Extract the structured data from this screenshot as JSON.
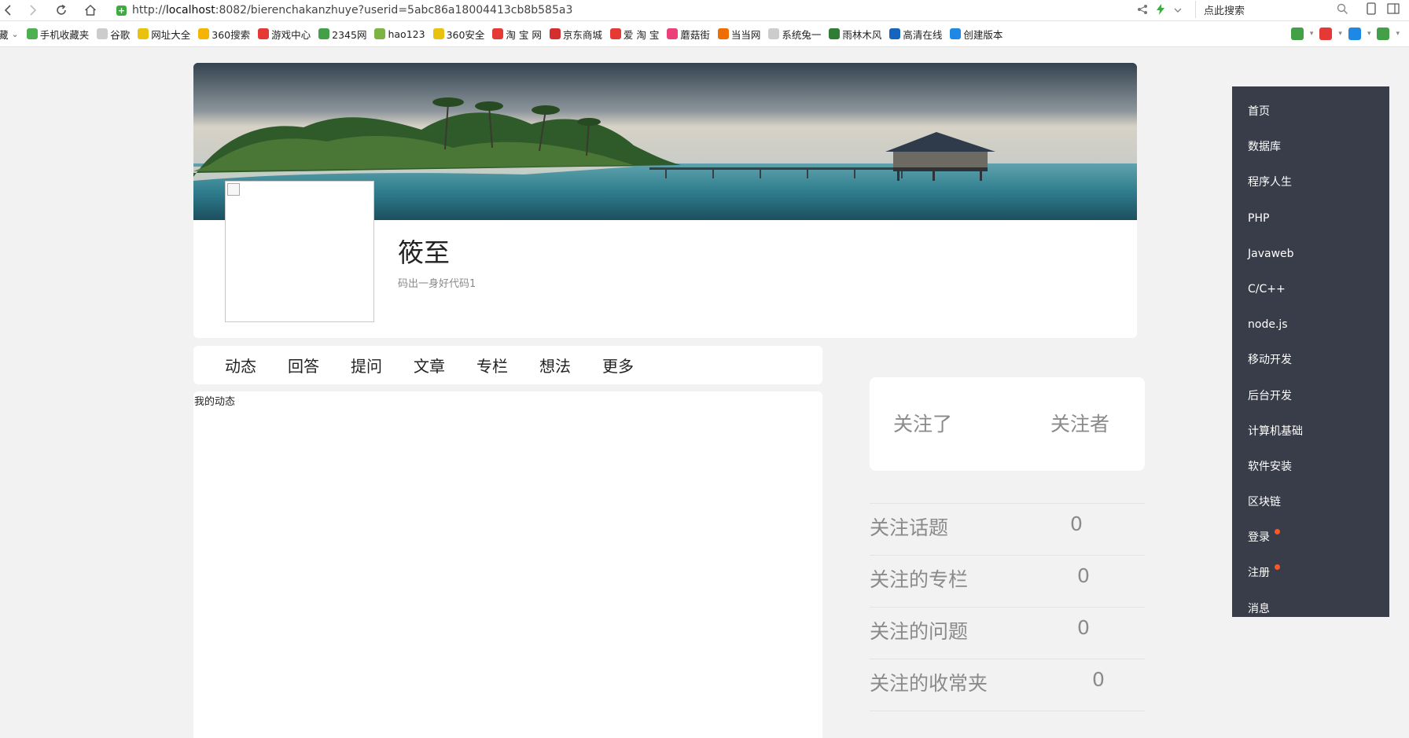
{
  "browser": {
    "url_prefix": "http://",
    "url_host": "localhost",
    "url_rest": ":8082/bierenchakanzhuye?userid=5abc86a18004413cb8b585a3",
    "search_placeholder": "点此搜索"
  },
  "bookmarks": [
    {
      "label": "藏",
      "icon": "folder-icon",
      "color": "#f0c419"
    },
    {
      "label": "手机收藏夹",
      "icon": "phone-icon",
      "color": "#4caf50"
    },
    {
      "label": "谷歌",
      "icon": "page-icon",
      "color": "#cccccc"
    },
    {
      "label": "网址大全",
      "icon": "sites-icon",
      "color": "#e8c20e"
    },
    {
      "label": "360搜索",
      "icon": "search360-icon",
      "color": "#f4b400"
    },
    {
      "label": "游戏中心",
      "icon": "game-icon",
      "color": "#e53935"
    },
    {
      "label": "2345网",
      "icon": "2345-icon",
      "color": "#43a047"
    },
    {
      "label": "hao123",
      "icon": "hao123-icon",
      "color": "#7cb342"
    },
    {
      "label": "360安全",
      "icon": "safe360-icon",
      "color": "#e8c20e"
    },
    {
      "label": "淘 宝 网",
      "icon": "taobao-icon",
      "color": "#e53935"
    },
    {
      "label": "京东商城",
      "icon": "jd-icon",
      "color": "#d32f2f"
    },
    {
      "label": "爱 淘 宝",
      "icon": "aitaobao-icon",
      "color": "#e53935"
    },
    {
      "label": "蘑菇街",
      "icon": "mogujie-icon",
      "color": "#ec407a"
    },
    {
      "label": "当当网",
      "icon": "dangdang-icon",
      "color": "#ef6c00"
    },
    {
      "label": "系统兔一",
      "icon": "page-icon",
      "color": "#cccccc"
    },
    {
      "label": "雨林木风",
      "icon": "tree-icon",
      "color": "#2e7d32"
    },
    {
      "label": "高清在线",
      "icon": "video-icon",
      "color": "#1565c0"
    },
    {
      "label": "创建版本",
      "icon": "rocket-icon",
      "color": "#1e88e5"
    }
  ],
  "profile": {
    "name": "筱至",
    "bio": "码出一身好代码1"
  },
  "tabs": [
    "动态",
    "回答",
    "提问",
    "文章",
    "专栏",
    "想法",
    "更多"
  ],
  "feed": {
    "title": "我的动态"
  },
  "follow": {
    "following_label": "关注了",
    "followers_label": "关注者"
  },
  "stats": [
    {
      "label": "关注话题",
      "value": "0"
    },
    {
      "label": "关注的专栏",
      "value": "0"
    },
    {
      "label": "关注的问题",
      "value": "0"
    },
    {
      "label": "关注的收常夹",
      "value": "0"
    }
  ],
  "side_menu": [
    {
      "label": "首页",
      "badge": false
    },
    {
      "label": "数据库",
      "badge": false
    },
    {
      "label": "程序人生",
      "badge": false
    },
    {
      "label": "PHP",
      "badge": false
    },
    {
      "label": "Javaweb",
      "badge": false
    },
    {
      "label": "C/C++",
      "badge": false
    },
    {
      "label": "node.js",
      "badge": false
    },
    {
      "label": "移动开发",
      "badge": false
    },
    {
      "label": "后台开发",
      "badge": false
    },
    {
      "label": "计算机基础",
      "badge": false
    },
    {
      "label": "软件安装",
      "badge": false
    },
    {
      "label": "区块链",
      "badge": false
    },
    {
      "label": "登录",
      "badge": true
    },
    {
      "label": "注册",
      "badge": true
    },
    {
      "label": "消息",
      "badge": false
    }
  ],
  "colors": {
    "menu_bg": "#393d49",
    "badge": "#ff5722",
    "page_bg": "#f2f2f2",
    "secure": "#3dab3d"
  }
}
